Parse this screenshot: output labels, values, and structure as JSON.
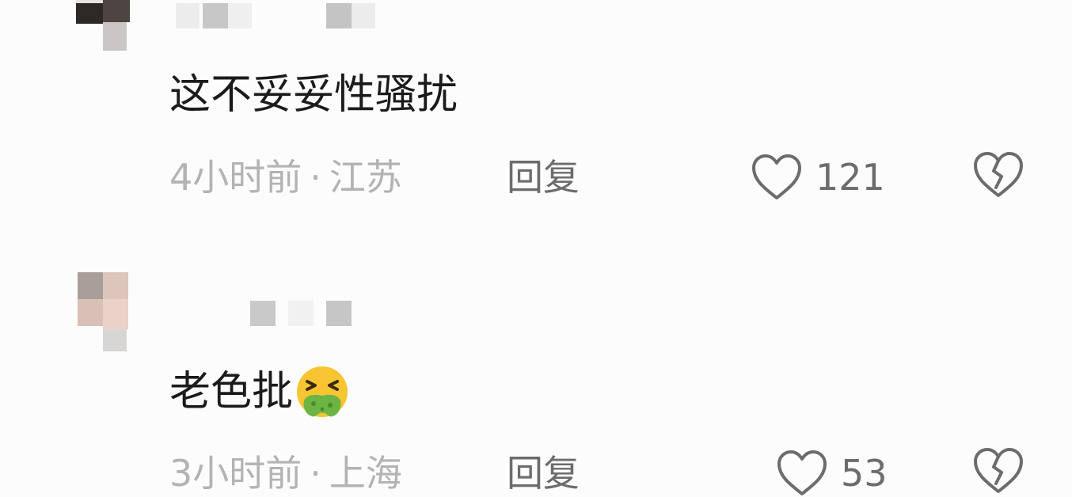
{
  "comments": [
    {
      "text": "这不妥妥性骚扰",
      "time": "4小时前",
      "separator": "·",
      "location": "江苏",
      "reply_label": "回复",
      "likes": "121",
      "icons": [
        "avatar-pixelated",
        "heart-outline-icon",
        "broken-heart-icon"
      ]
    },
    {
      "text": "老色批",
      "emoji": "nauseated-face-emoji",
      "time": "3小时前",
      "separator": "·",
      "location": "上海",
      "reply_label": "回复",
      "likes": "53",
      "icons": [
        "avatar-pixelated",
        "heart-outline-icon",
        "broken-heart-icon"
      ]
    }
  ],
  "colors": {
    "background": "#fcfcfc",
    "text_primary": "#1b1b1b",
    "text_meta": "#b3b3b3",
    "text_action": "#6c6c6c"
  }
}
